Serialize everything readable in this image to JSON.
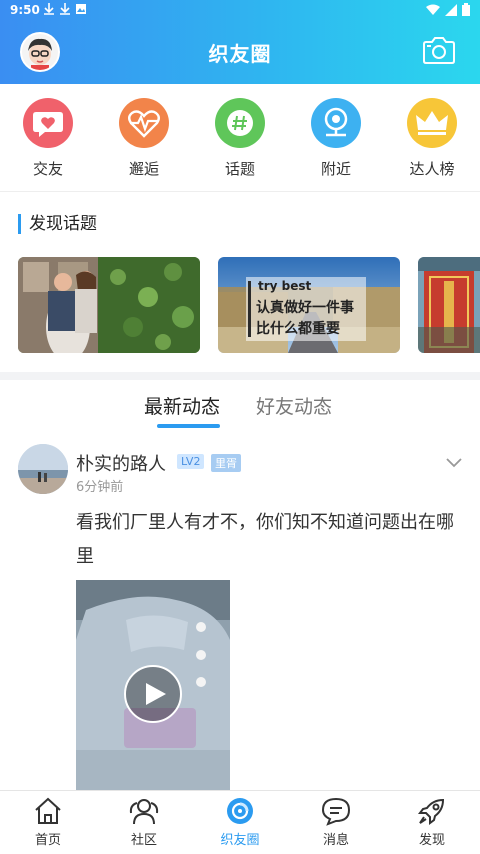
{
  "status_bar": {
    "time": "9:50"
  },
  "header": {
    "title": "织友圈"
  },
  "categories": [
    {
      "label": "交友",
      "icon": "heart-chat-icon",
      "color": "#f0616b"
    },
    {
      "label": "邂逅",
      "icon": "heartbeat-icon",
      "color": "#f2844a"
    },
    {
      "label": "话题",
      "icon": "hashtag-icon",
      "color": "#5fc65a"
    },
    {
      "label": "附近",
      "icon": "location-icon",
      "color": "#3db1f1"
    },
    {
      "label": "达人榜",
      "icon": "crown-icon",
      "color": "#f7c638"
    }
  ],
  "discover": {
    "title": "发现话题",
    "topics": [
      {
        "image": "couple-photo"
      },
      {
        "image": "try-best-road",
        "tag": "try best",
        "line1": "认真做好一件事",
        "line2": "比什么都重要"
      },
      {
        "image": "red-door"
      }
    ]
  },
  "tabs": [
    {
      "label": "最新动态",
      "active": true
    },
    {
      "label": "好友动态",
      "active": false
    }
  ],
  "post": {
    "username": "朴实的路人",
    "level": "LV2",
    "role": "里胥",
    "time": "6分钟前",
    "text": "看我们厂里人有才不，你们知不知道问题出在哪里"
  },
  "bottom_nav": [
    {
      "label": "首页",
      "icon": "home-icon",
      "active": false
    },
    {
      "label": "社区",
      "icon": "community-icon",
      "active": false
    },
    {
      "label": "织友圈",
      "icon": "circle-friends-icon",
      "active": true
    },
    {
      "label": "消息",
      "icon": "message-icon",
      "active": false
    },
    {
      "label": "发现",
      "icon": "rocket-icon",
      "active": false
    }
  ]
}
